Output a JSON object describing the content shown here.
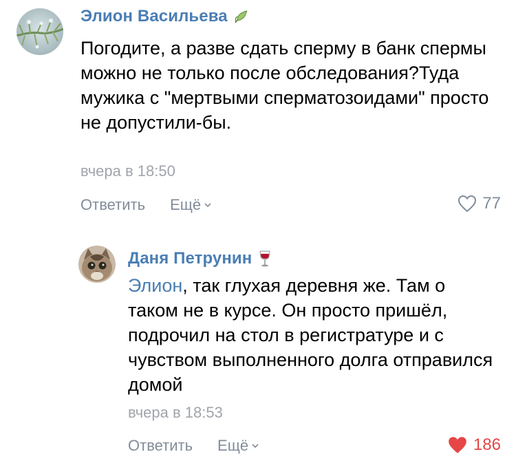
{
  "comments": [
    {
      "author": "Элион Васильева",
      "badge_icon": "leaf-icon",
      "text": "Погодите, а разве сдать сперму в банк спермы можно не только после обследования?Туда мужика с \"мертвыми сперматозоидами\" просто не допустили-бы.",
      "time": "вчера в 18:50",
      "reply_label": "Ответить",
      "more_label": "Ещё",
      "likes": "77",
      "liked": false
    },
    {
      "author": "Даня Петрунин",
      "badge_icon": "wine-glass-icon",
      "mention": "Элион",
      "text": ", так глухая деревня же. Там о таком не в курсе. Он просто пришёл, подрочил на стол в регистратуре и с чувством выполненного долга отправился домой",
      "time": "вчера в 18:53",
      "reply_label": "Ответить",
      "more_label": "Ещё",
      "likes": "186",
      "liked": true
    }
  ],
  "colors": {
    "link": "#4a7eb4",
    "meta": "#a0a5ab",
    "action": "#818c99",
    "like_active": "#e64646"
  }
}
